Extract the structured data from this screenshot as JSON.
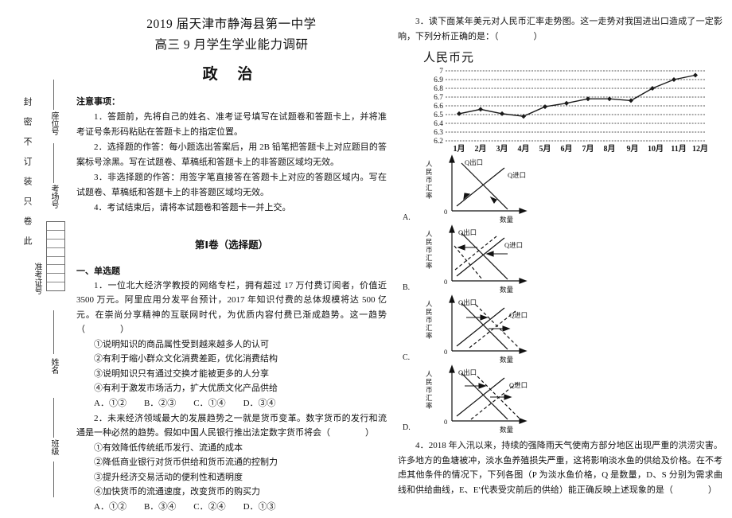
{
  "header": {
    "line1": "2019 届天津市静海县第一中学",
    "line2": "高三 9 月学生学业能力调研",
    "subject": "政 治"
  },
  "notice": {
    "heading": "注意事项：",
    "items": [
      "1．答题前，先将自己的姓名、准考证号填写在试题卷和答题卡上，并将准考证号条形码粘贴在答题卡上的指定位置。",
      "2．选择题的作答：每小题选出答案后，用 2B 铅笔把答题卡上对应题目的答案标号涂黑。写在试题卷、草稿纸和答题卡上的非答题区域均无效。",
      "3．非选择题的作答：用签字笔直接答在答题卡上对应的答题区域内。写在试题卷、草稿纸和答题卡上的非答题区域均无效。",
      "4．考试结束后，请将本试题卷和答题卡一并上交。"
    ]
  },
  "seal": {
    "chars": "封密不订装只卷此",
    "fields": [
      {
        "label": "座位号"
      },
      {
        "label": "考场号"
      },
      {
        "label": "准考证号"
      },
      {
        "label": "姓名"
      },
      {
        "label": "班级"
      }
    ]
  },
  "paper": {
    "title": "第Ⅰ卷（选择题）",
    "section_heading": "一、单选题"
  },
  "questions": [
    {
      "number": "1",
      "stem": "1．一位北大经济学教授的网络专栏，拥有超过 17 万付费订阅者，价值近 3500 万元。阿里应用分发平台预计，2017 年知识付费的总体规模将达 500 亿元。在崇尚分享精神的互联网时代，为优质内容付费已渐成趋势。这一趋势（　　　　）",
      "statements": [
        "①说明知识的商品属性受到越来越多人的认可",
        "②有利于缩小群众文化消费差距，优化消费结构",
        "③说明知识只有通过交换才能被更多的人分享",
        "④有利于激发市场活力，扩大优质文化产品供给"
      ],
      "answers": "A．①②　　B．②③　　C．①④　　D．③④"
    },
    {
      "number": "2",
      "stem": "2．未来经济领域最大的发展趋势之一就是货币变革。数字货币的发行和流通是一种必然的趋势。假如中国人民银行推出法定数字货币将会（　　　　）",
      "statements": [
        "①有效降低传统纸币发行、流通的成本",
        "②降低商业银行对货币供给和货币流通的控制力",
        "③提升经济交易活动的便利性和透明度",
        "④加快货币的流通速度，改变货币的购买力"
      ],
      "answers": "A．①②　　B．③④　　C．②④　　D．①③"
    },
    {
      "number": "3",
      "stem": "3．读下面某年美元对人民币汇率走势图。这一走势对我国进出口造成了一定影响，下列分析正确的是：（　　　　）"
    },
    {
      "number": "4",
      "stem": "4．2018 年入汛以来，持续的强降雨天气使南方部分地区出现严重的洪涝灾害。许多地方的鱼塘被冲，淡水鱼养殖损失严重，这将影响淡水鱼的供给及价格。在不考虑其他条件的情况下，下列各图（P 为淡水鱼价格，Q 是数量，D、S 分别为需求曲线和供给曲线，E、E′代表受灾前后的供给）能正确反映上述现象的是（　　　　）"
    }
  ],
  "chart_data": {
    "type": "line",
    "title": "人民币元",
    "xlabel": "",
    "ylabel": "人民币元",
    "categories": [
      "1月",
      "2月",
      "3月",
      "4月",
      "5月",
      "6月",
      "7月",
      "8月",
      "9月",
      "10月",
      "11月",
      "12月"
    ],
    "values": [
      6.51,
      6.56,
      6.51,
      6.48,
      6.59,
      6.63,
      6.68,
      6.68,
      6.66,
      6.8,
      6.9,
      6.95
    ],
    "ylim": [
      6.2,
      7.0
    ],
    "yticks": [
      "7",
      "6.9",
      "6.8",
      "6.7",
      "6.6",
      "6.5",
      "6.4",
      "6.3",
      "6.2"
    ],
    "grid": true,
    "legend": "none",
    "marker": "diamond",
    "line_color": "#222222"
  },
  "option_diagrams": {
    "axis_y_label": "人民币汇率",
    "axis_x_label": "数量",
    "origin_label": "0",
    "curve_export": "Q出口",
    "curve_import": "Q进口",
    "options": [
      {
        "label": "A.",
        "note": "出口曲线下倾，进口曲线上倾，箭头相向"
      },
      {
        "label": "B.",
        "note": "两条曲线向左移动，虚线，箭头向左"
      },
      {
        "label": "C.",
        "note": "出口曲线左移，进口曲线左移，虚线箭头向左"
      },
      {
        "label": "D.",
        "note": "两条曲线向右移动，虚线，箭头向右"
      }
    ]
  }
}
